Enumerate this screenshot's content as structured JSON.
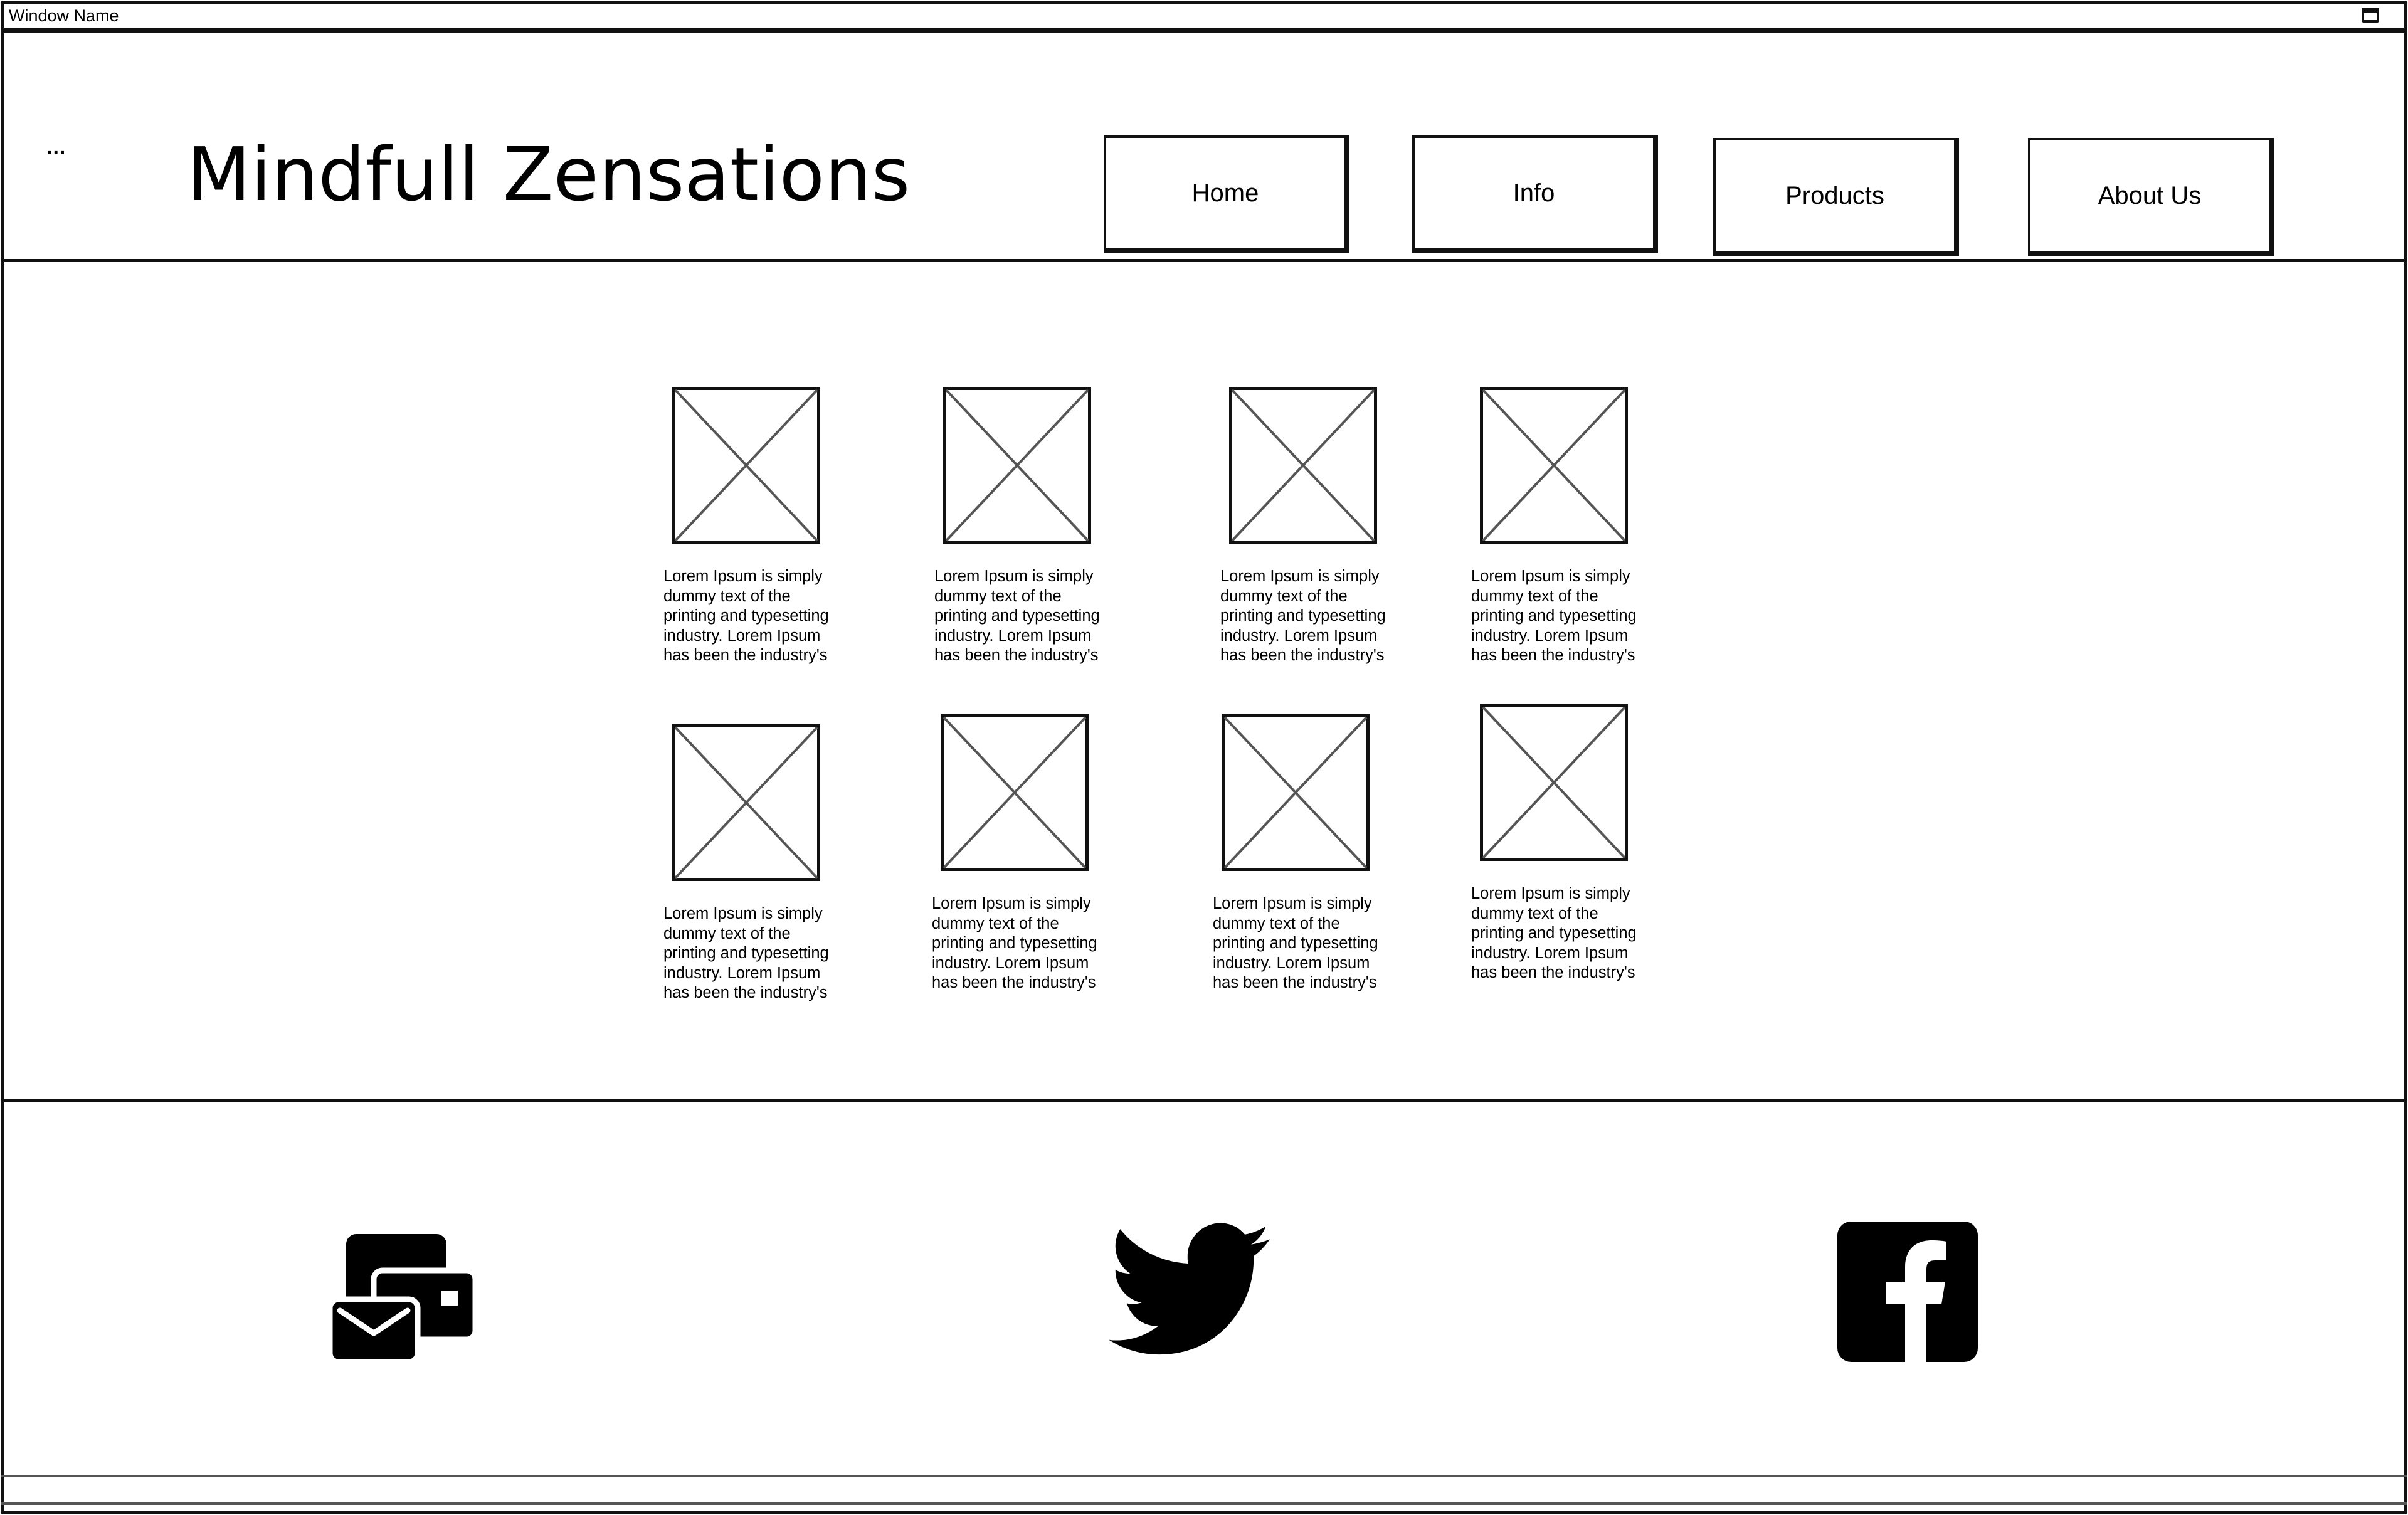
{
  "window": {
    "title": "Window Name"
  },
  "header": {
    "menu_label": "...",
    "site_title": "Mindfull Zensations",
    "nav": [
      {
        "label": "Home"
      },
      {
        "label": "Info"
      },
      {
        "label": "Products"
      },
      {
        "label": "About Us"
      }
    ]
  },
  "gallery": {
    "items": [
      {
        "image_icon": "image-placeholder-icon",
        "caption": "Lorem Ipsum is simply dummy text of the printing and typesetting industry. Lorem Ipsum has been the industry's"
      },
      {
        "image_icon": "image-placeholder-icon",
        "caption": "Lorem Ipsum is simply dummy text of the printing and typesetting industry. Lorem Ipsum has been the industry's"
      },
      {
        "image_icon": "image-placeholder-icon",
        "caption": "Lorem Ipsum is simply dummy text of the printing and typesetting industry. Lorem Ipsum has been the industry's"
      },
      {
        "image_icon": "image-placeholder-icon",
        "caption": "Lorem Ipsum is simply dummy text of the printing and typesetting industry. Lorem Ipsum has been the industry's"
      },
      {
        "image_icon": "image-placeholder-icon",
        "caption": "Lorem Ipsum is simply dummy text of the printing and typesetting industry. Lorem Ipsum has been the industry's"
      },
      {
        "image_icon": "image-placeholder-icon",
        "caption": "Lorem Ipsum is simply dummy text of the printing and typesetting industry. Lorem Ipsum has been the industry's"
      },
      {
        "image_icon": "image-placeholder-icon",
        "caption": "Lorem Ipsum is simply dummy text of the printing and typesetting industry. Lorem Ipsum has been the industry's"
      },
      {
        "image_icon": "image-placeholder-icon",
        "caption": "Lorem Ipsum is simply dummy text of the printing and typesetting industry. Lorem Ipsum has been the industry's"
      }
    ]
  },
  "footer": {
    "social": [
      {
        "icon": "email-icon"
      },
      {
        "icon": "twitter-icon"
      },
      {
        "icon": "facebook-icon"
      }
    ]
  },
  "colors": {
    "ink": "#111111",
    "background": "#ffffff",
    "placeholder_stroke": "#555555"
  }
}
